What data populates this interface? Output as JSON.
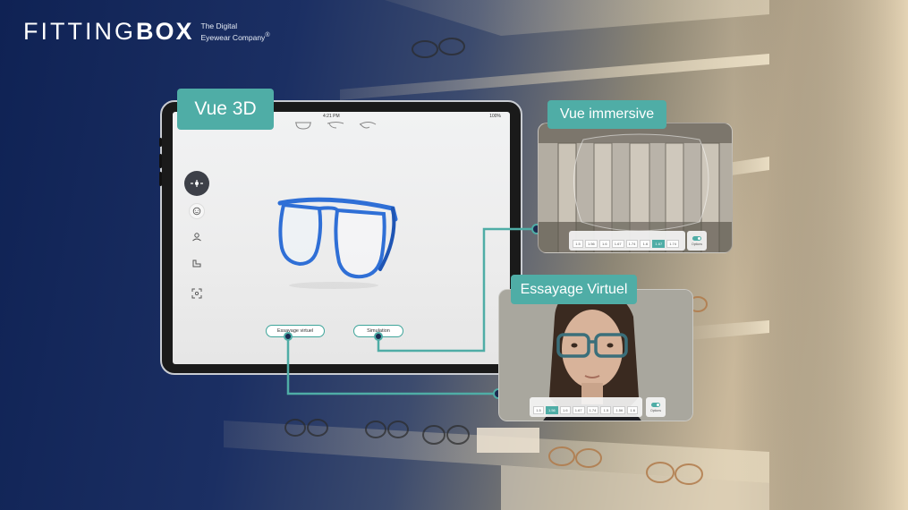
{
  "brand": {
    "name_light": "FITTING",
    "name_bold": "BOX",
    "tagline_line1": "The Digital",
    "tagline_line2": "Eyewear Company",
    "registered": "®"
  },
  "badges": {
    "vue3d": "Vue 3D",
    "immersive": "Vue immersive",
    "tryon": "Essayage Virtuel"
  },
  "tablet": {
    "status_time": "4:21 PM",
    "status_battery": "100%",
    "pill_tryon": "Essayage virtuel",
    "pill_simulation": "Simulation",
    "tools": [
      "360-rotate-icon",
      "face-icon",
      "user-location-icon",
      "lens-icon",
      "scan-frame-icon"
    ]
  },
  "immersive_controls": {
    "buttons": [
      "1.5",
      "1.56",
      "1.6",
      "1.67",
      "1.74",
      "1.6",
      "1.67",
      "1.74"
    ],
    "active_index": 6,
    "toggle_label": "Options"
  },
  "tryon_controls": {
    "buttons": [
      "1.5",
      "1.56",
      "1.6",
      "1.67",
      "1.74",
      "1.5",
      "1.56",
      "1.6",
      "1.67",
      "1.74"
    ],
    "active_index": 1,
    "toggle_label": "Options"
  },
  "colors": {
    "accent": "#4fada6",
    "frame_blue": "#2f6fd6",
    "background_navy": "#0f2254"
  }
}
